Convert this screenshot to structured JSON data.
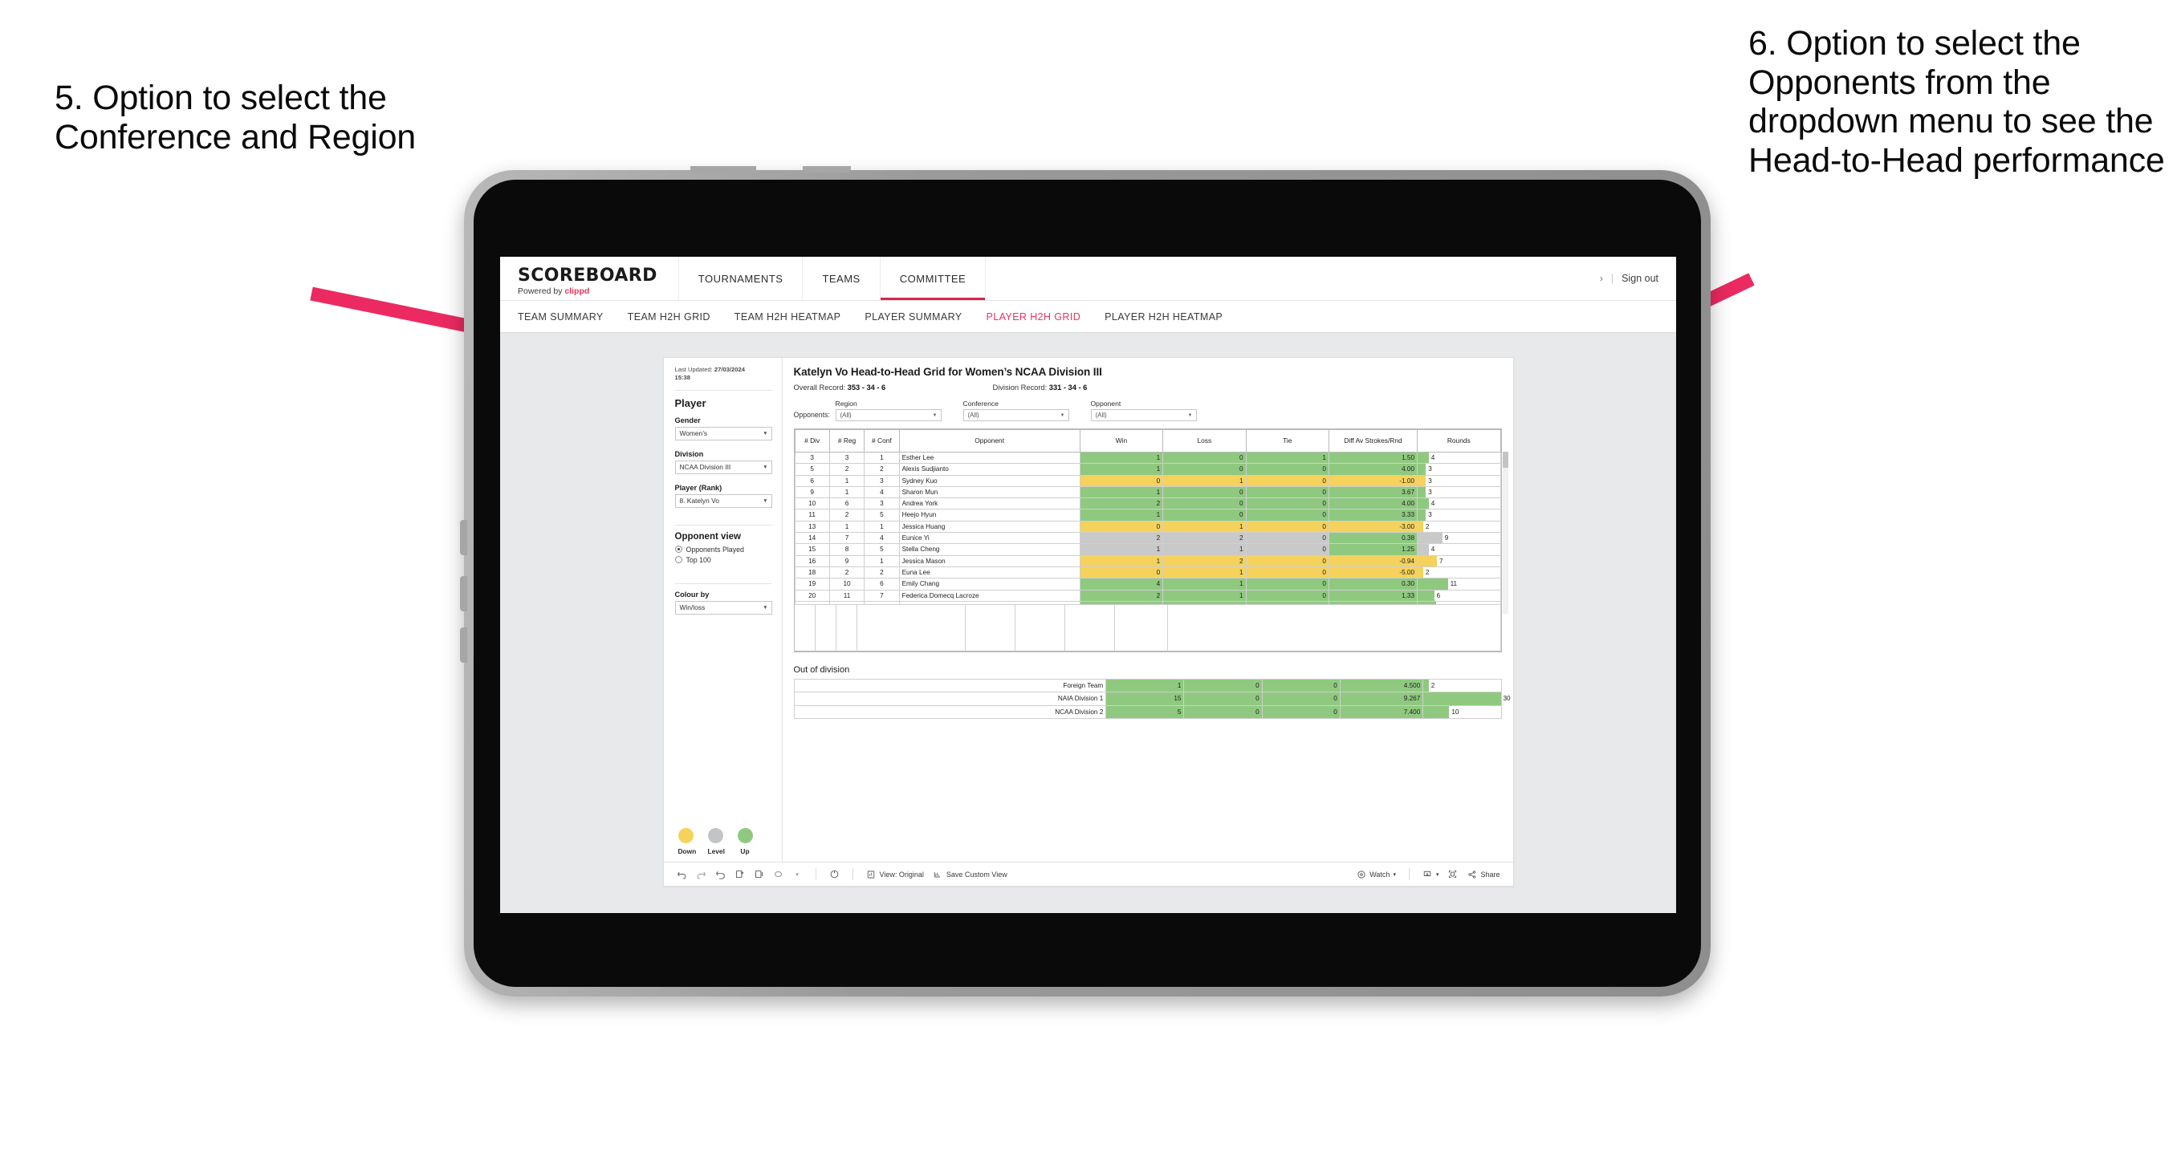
{
  "annotations": {
    "left": "5. Option to select the Conference and Region",
    "right": "6. Option to select the Opponents from the dropdown menu to see the Head-to-Head performance",
    "arrow_color": "#ea2a61"
  },
  "app": {
    "logo": "SCOREBOARD",
    "logo_sub_prefix": "Powered by ",
    "logo_sub_brand": "clippd",
    "topnav": [
      {
        "label": "TOURNAMENTS",
        "active": false
      },
      {
        "label": "TEAMS",
        "active": false
      },
      {
        "label": "COMMITTEE",
        "active": true
      }
    ],
    "header_right": {
      "chevron": "›",
      "separator": "|",
      "sign_out": "Sign out"
    },
    "subnav": [
      {
        "label": "TEAM SUMMARY",
        "active": false
      },
      {
        "label": "TEAM H2H GRID",
        "active": false
      },
      {
        "label": "TEAM H2H HEATMAP",
        "active": false
      },
      {
        "label": "PLAYER SUMMARY",
        "active": false
      },
      {
        "label": "PLAYER H2H GRID",
        "active": true
      },
      {
        "label": "PLAYER H2H HEATMAP",
        "active": false
      }
    ],
    "accent": "#e8365d"
  },
  "sidebar": {
    "last_updated_label": "Last Updated: ",
    "last_updated_value": "27/03/2024",
    "last_updated_time": "15:38",
    "player_heading": "Player",
    "gender": {
      "label": "Gender",
      "value": "Women’s"
    },
    "division": {
      "label": "Division",
      "value": "NCAA Division III"
    },
    "player_rank": {
      "label": "Player (Rank)",
      "value": "8. Katelyn Vo"
    },
    "opponent_view": {
      "heading": "Opponent view",
      "options": [
        {
          "label": "Opponents Played",
          "selected": true
        },
        {
          "label": "Top 100",
          "selected": false
        }
      ]
    },
    "colour_by": {
      "label": "Colour by",
      "value": "Win/loss"
    },
    "legend": [
      {
        "label": "Down",
        "color": "#f5d25b"
      },
      {
        "label": "Level",
        "color": "#c2c4c6"
      },
      {
        "label": "Up",
        "color": "#8fc97f"
      }
    ]
  },
  "main": {
    "title": "Katelyn Vo Head-to-Head Grid for Women’s NCAA Division III",
    "overall_record_label": "Overall Record: ",
    "overall_record_value": "353 - 34 - 6",
    "division_record_label": "Division Record: ",
    "division_record_value": "331 - 34 - 6",
    "opponents_label": "Opponents:",
    "filters": [
      {
        "label": "Region",
        "value": "(All)"
      },
      {
        "label": "Conference",
        "value": "(All)"
      },
      {
        "label": "Opponent",
        "value": "(All)"
      }
    ]
  },
  "chart_data": {
    "type": "table",
    "title": "Katelyn Vo Head-to-Head Grid for Women’s NCAA Division III",
    "columns": [
      "# Div",
      "# Reg",
      "# Conf",
      "Opponent",
      "Win",
      "Loss",
      "Tie",
      "Diff Av Strokes/Rnd",
      "Rounds"
    ],
    "rows": [
      {
        "div": "3",
        "reg": "3",
        "conf": "1",
        "opponent": "Esther Lee",
        "win": "1",
        "loss": "0",
        "tie": "1",
        "diff": "1.50",
        "rounds": "4",
        "state": "up"
      },
      {
        "div": "5",
        "reg": "2",
        "conf": "2",
        "opponent": "Alexis Sudjianto",
        "win": "1",
        "loss": "0",
        "tie": "0",
        "diff": "4.00",
        "rounds": "3",
        "state": "up"
      },
      {
        "div": "6",
        "reg": "1",
        "conf": "3",
        "opponent": "Sydney Kuo",
        "win": "0",
        "loss": "1",
        "tie": "0",
        "diff": "-1.00",
        "rounds": "3",
        "state": "down"
      },
      {
        "div": "9",
        "reg": "1",
        "conf": "4",
        "opponent": "Sharon Mun",
        "win": "1",
        "loss": "0",
        "tie": "0",
        "diff": "3.67",
        "rounds": "3",
        "state": "up"
      },
      {
        "div": "10",
        "reg": "6",
        "conf": "3",
        "opponent": "Andrea York",
        "win": "2",
        "loss": "0",
        "tie": "0",
        "diff": "4.00",
        "rounds": "4",
        "state": "up"
      },
      {
        "div": "11",
        "reg": "2",
        "conf": "5",
        "opponent": "Heejo Hyun",
        "win": "1",
        "loss": "0",
        "tie": "0",
        "diff": "3.33",
        "rounds": "3",
        "state": "up"
      },
      {
        "div": "13",
        "reg": "1",
        "conf": "1",
        "opponent": "Jessica Huang",
        "win": "0",
        "loss": "1",
        "tie": "0",
        "diff": "-3.00",
        "rounds": "2",
        "state": "down"
      },
      {
        "div": "14",
        "reg": "7",
        "conf": "4",
        "opponent": "Eunice Yi",
        "win": "2",
        "loss": "2",
        "tie": "0",
        "diff": "0.38",
        "rounds": "9",
        "state": "level",
        "diff_state": "up"
      },
      {
        "div": "15",
        "reg": "8",
        "conf": "5",
        "opponent": "Stella Cheng",
        "win": "1",
        "loss": "1",
        "tie": "0",
        "diff": "1.25",
        "rounds": "4",
        "state": "level",
        "diff_state": "up"
      },
      {
        "div": "16",
        "reg": "9",
        "conf": "1",
        "opponent": "Jessica Mason",
        "win": "1",
        "loss": "2",
        "tie": "0",
        "diff": "-0.94",
        "rounds": "7",
        "state": "down"
      },
      {
        "div": "18",
        "reg": "2",
        "conf": "2",
        "opponent": "Euna Lee",
        "win": "0",
        "loss": "1",
        "tie": "0",
        "diff": "-5.00",
        "rounds": "2",
        "state": "down"
      },
      {
        "div": "19",
        "reg": "10",
        "conf": "6",
        "opponent": "Emily Chang",
        "win": "4",
        "loss": "1",
        "tie": "0",
        "diff": "0.30",
        "rounds": "11",
        "state": "up"
      },
      {
        "div": "20",
        "reg": "11",
        "conf": "7",
        "opponent": "Federica Domecq Lacroze",
        "win": "2",
        "loss": "1",
        "tie": "0",
        "diff": "1.33",
        "rounds": "6",
        "state": "up"
      }
    ],
    "out_of_division": {
      "title": "Out of division",
      "rows": [
        {
          "name": "Foreign Team",
          "win": "1",
          "loss": "0",
          "tie": "0",
          "diff": "4.500",
          "rounds": "2",
          "state": "up"
        },
        {
          "name": "NAIA Division 1",
          "win": "15",
          "loss": "0",
          "tie": "0",
          "diff": "9.267",
          "rounds": "30",
          "state": "up"
        },
        {
          "name": "NCAA Division 2",
          "win": "5",
          "loss": "0",
          "tie": "0",
          "diff": "7.400",
          "rounds": "10",
          "state": "up"
        }
      ]
    },
    "colors": {
      "up": "#8fc97f",
      "down": "#f5d25b",
      "level": "#c9c9c9"
    },
    "rounds_max": 30
  },
  "toolbar": {
    "view_label": "View: Original",
    "save_label": "Save Custom View",
    "watch_label": "Watch",
    "share_label": "Share",
    "caret": "▾"
  }
}
